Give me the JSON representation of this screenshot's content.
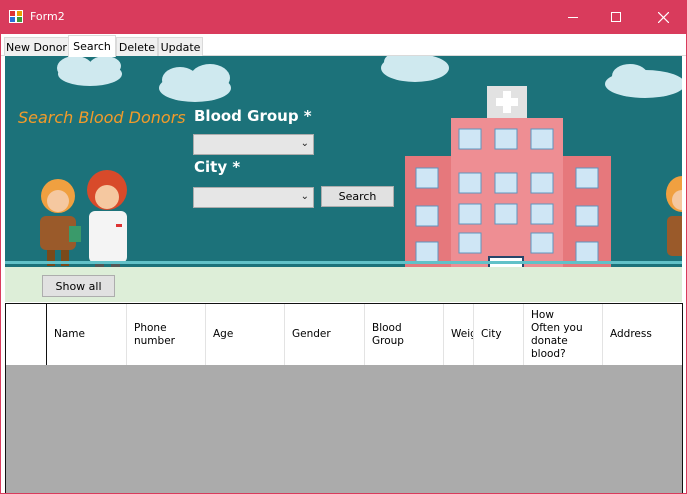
{
  "window": {
    "title": "Form2",
    "accent_color": "#d93b5c"
  },
  "tabs": [
    {
      "label": "New Donor",
      "active": false
    },
    {
      "label": "Search",
      "active": true
    },
    {
      "label": "Delete",
      "active": false
    },
    {
      "label": "Update",
      "active": false
    }
  ],
  "search": {
    "heading": "Search Blood Donors",
    "blood_group_label": "Blood Group *",
    "blood_group_value": "",
    "city_label": "City *",
    "city_value": "",
    "search_button": "Search",
    "show_all_button": "Show all"
  },
  "grid": {
    "columns": [
      {
        "label": ""
      },
      {
        "label": "Name"
      },
      {
        "label": "Phone\nnumber"
      },
      {
        "label": "Age"
      },
      {
        "label": "Gender"
      },
      {
        "label": "Blood\nGroup"
      },
      {
        "label": "Weig"
      },
      {
        "label": "City"
      },
      {
        "label": "How\nOften you\ndonate\nblood?"
      },
      {
        "label": "Address"
      }
    ],
    "rows": []
  },
  "colors": {
    "banner_bg": "#1c727a",
    "heading_orange": "#f29b2a",
    "grid_empty_bg": "#ababab",
    "hospital_pink": "#e8868a"
  }
}
